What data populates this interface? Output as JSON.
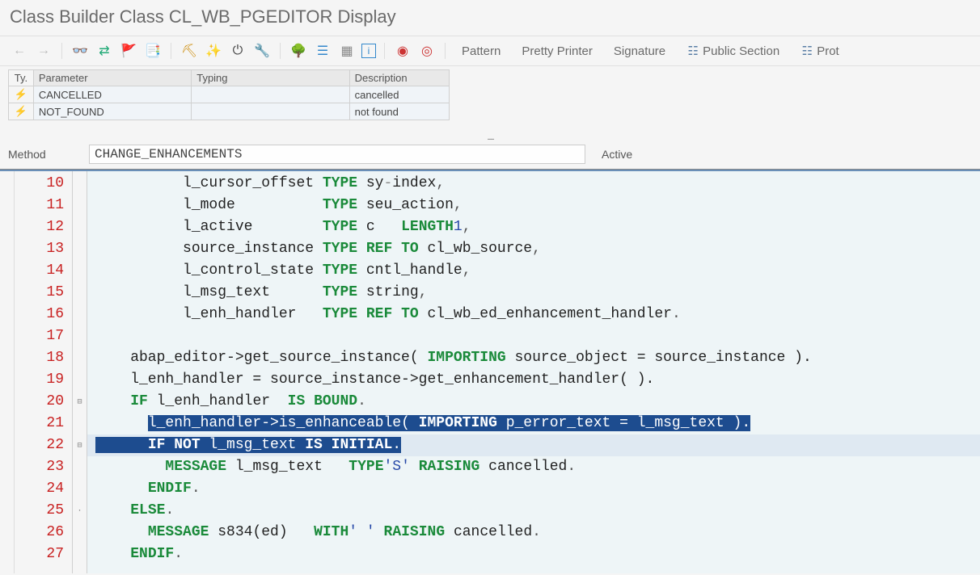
{
  "title": "Class Builder Class CL_WB_PGEDITOR Display",
  "toolbar": {
    "pattern": "Pattern",
    "pretty_printer": "Pretty Printer",
    "signature": "Signature",
    "public_section": "Public Section",
    "prot_section": "Prot"
  },
  "params": {
    "headers": {
      "ty": "Ty.",
      "param": "Parameter",
      "typing": "Typing",
      "desc": "Description"
    },
    "rows": [
      {
        "name": "CANCELLED",
        "typing": "",
        "desc": "cancelled"
      },
      {
        "name": "NOT_FOUND",
        "typing": "",
        "desc": "not found"
      }
    ]
  },
  "method": {
    "label": "Method",
    "name": "CHANGE_ENHANCEMENTS",
    "status": "Active"
  },
  "code": {
    "first_line_no": 10,
    "lines": [
      {
        "n": 10,
        "t": "          l_cursor_offset ",
        "kw": "TYPE",
        "r": " sy",
        "op": "-",
        "r2": "index",
        "end": ","
      },
      {
        "n": 11,
        "t": "          l_mode          ",
        "kw": "TYPE",
        "r": " seu_action",
        "end": ","
      },
      {
        "n": 12,
        "t": "          l_active        ",
        "kw": "TYPE",
        "r": " c ",
        "kw2": "LENGTH",
        "r2": " ",
        "num": "1",
        "end": ","
      },
      {
        "n": 13,
        "t": "          source_instance ",
        "kw": "TYPE REF TO",
        "r": " cl_wb_source",
        "end": ","
      },
      {
        "n": 14,
        "t": "          l_control_state ",
        "kw": "TYPE",
        "r": " cntl_handle",
        "end": ","
      },
      {
        "n": 15,
        "t": "          l_msg_text      ",
        "kw": "TYPE",
        "r": " string",
        "end": ","
      },
      {
        "n": 16,
        "t": "          l_enh_handler   ",
        "kw": "TYPE REF TO",
        "r": " cl_wb_ed_enhancement_handler",
        "end": "."
      },
      {
        "n": 17,
        "t": ""
      },
      {
        "n": 18,
        "t": "    abap_editor->get_source_instance( ",
        "kw": "IMPORTING",
        "r": " source_object = source_instance ).",
        "end": ""
      },
      {
        "n": 19,
        "t": "    l_enh_handler = source_instance->get_enhancement_handler( ).",
        "end": ""
      },
      {
        "n": 20,
        "t": "    ",
        "kw": "IF",
        "r": " l_enh_handler ",
        "kw2": "IS BOUND",
        "end": ".",
        "fold": "⊟"
      },
      {
        "n": 21,
        "sel": true,
        "pre": "      ",
        "body": "l_enh_handler->is_enhanceable( IMPORTING p_error_text = l_msg_text )."
      },
      {
        "n": 22,
        "sel": true,
        "current": true,
        "fold": "⊟",
        "pre": "      ",
        "body_kw": "IF NOT",
        "body_mid": " l_msg_text ",
        "body_kw2": "IS INITIAL",
        "body_end": "."
      },
      {
        "n": 23,
        "t": "        ",
        "kw": "MESSAGE",
        "r": " l_msg_text ",
        "kw2": "TYPE",
        "r2": " ",
        "str": "'S'",
        "r3": " ",
        "kw3": "RAISING",
        "r4": " cancelled",
        "end": "."
      },
      {
        "n": 24,
        "t": "      ",
        "kw": "ENDIF",
        "end": "."
      },
      {
        "n": 25,
        "t": "    ",
        "kw": "ELSE",
        "end": ".",
        "fold": "·"
      },
      {
        "n": 26,
        "t": "      ",
        "kw": "MESSAGE",
        "r": " s834(ed) ",
        "kw2": "WITH",
        "r2": " ",
        "str": "' '",
        "r3": " ",
        "kw3": "RAISING",
        "r4": " cancelled",
        "end": "."
      },
      {
        "n": 27,
        "t": "    ",
        "kw": "ENDIF",
        "end": "."
      }
    ]
  }
}
